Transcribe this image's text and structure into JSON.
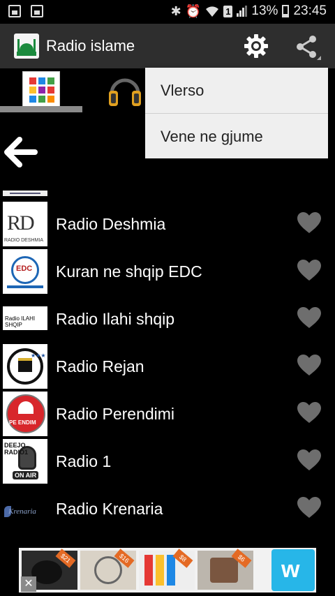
{
  "status_bar": {
    "battery_percent": "13%",
    "time": "23:45",
    "sim_slot": "1",
    "icons": [
      "gallery-notification-icon",
      "image-notification-icon",
      "bluetooth-icon",
      "alarm-icon",
      "wifi-icon",
      "signal-icon",
      "battery-icon"
    ]
  },
  "action_bar": {
    "title": "Radio islame",
    "icons": [
      "app-logo-icon",
      "settings-gear-icon",
      "share-icon"
    ]
  },
  "tabs": {
    "icons": [
      "grid-apps-icon",
      "headphones-icon"
    ],
    "selected": 0
  },
  "overflow_menu": {
    "items": [
      "Vlerso",
      "Vene ne gjume"
    ]
  },
  "back_icon": "back-arrow-icon",
  "stations": [
    {
      "name": "Radio Deshmia",
      "thumb_text": "RD",
      "thumb_sub": "RADIO DESHMIA"
    },
    {
      "name": "Kuran ne shqip EDC",
      "thumb_text": "EDC"
    },
    {
      "name": "Radio Ilahi shqip",
      "thumb_text": "Radio ILAHI SHQIP"
    },
    {
      "name": "Radio Rejan",
      "thumb_text": "STUDIO REJAN"
    },
    {
      "name": "Radio Perendimi",
      "thumb_text": "PE ENDIM"
    },
    {
      "name": "Radio 1",
      "thumb_text": "DEEJO RADIO1",
      "thumb_sub": "ON AIR"
    },
    {
      "name": "Radio Krenaria",
      "thumb_text": "Krenaria"
    }
  ],
  "ad": {
    "price_tags": [
      "$21",
      "$16",
      "$8",
      "$6"
    ],
    "brand_glyph": "w",
    "close_label": "✕"
  },
  "colors": {
    "action_bar": "#2e2e2e",
    "menu_bg": "#efefef",
    "heart": "#6e6e6e",
    "wish_blue": "#27b6e8"
  }
}
